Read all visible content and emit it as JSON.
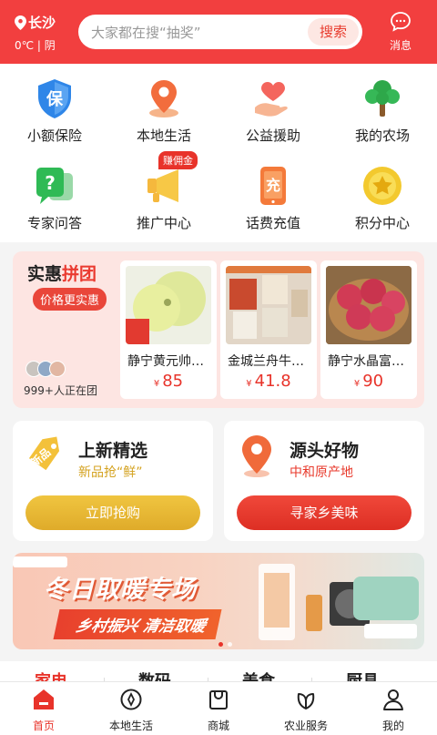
{
  "header": {
    "city": "长沙",
    "weather": "0℃ | 阴",
    "search_placeholder": "大家都在搜“抽奖”",
    "search_button": "搜索",
    "message_label": "消息"
  },
  "services": [
    {
      "label": "小额保险",
      "icon": "shield-bao-icon"
    },
    {
      "label": "本地生活",
      "icon": "map-pin-icon"
    },
    {
      "label": "公益援助",
      "icon": "hand-heart-icon"
    },
    {
      "label": "我的农场",
      "icon": "tree-icon"
    },
    {
      "label": "专家问答",
      "icon": "question-chat-icon"
    },
    {
      "label": "推广中心",
      "icon": "megaphone-icon"
    },
    {
      "label": "话费充值",
      "icon": "phone-charge-icon"
    },
    {
      "label": "积分中心",
      "icon": "star-coin-icon"
    }
  ],
  "promo_badge": "赚佣金",
  "group_buy": {
    "title_main": "实惠",
    "title_accent": "拼团",
    "subtitle": "价格更实惠",
    "participants": "999+人正在团",
    "products": [
      {
        "name": "静宁黄元帅苹果",
        "price": "85",
        "currency": "¥"
      },
      {
        "name": "金城兰舟牛肉面",
        "price": "41.8",
        "currency": "¥"
      },
      {
        "name": "静宁水晶富士苹果",
        "price": "90",
        "currency": "¥"
      }
    ]
  },
  "features": [
    {
      "title": "上新精选",
      "subtitle": "新品抢“鲜”",
      "button": "立即抢购",
      "icon": "new-tag-icon",
      "color": "#e5b935"
    },
    {
      "title": "源头好物",
      "subtitle": "中和原产地",
      "button": "寻家乡美味",
      "icon": "location-pin-icon",
      "color": "#e83a2c"
    }
  ],
  "banner": {
    "title": "冬日取暖专场",
    "ribbon": "乡村振兴 清洁取暖"
  },
  "categories": [
    "家电",
    "数码",
    "美食",
    "厨具"
  ],
  "nav": [
    {
      "label": "首页",
      "icon": "home-icon",
      "active": true
    },
    {
      "label": "本地生活",
      "icon": "compass-icon",
      "active": false
    },
    {
      "label": "商城",
      "icon": "shopping-bag-icon",
      "active": false
    },
    {
      "label": "农业服务",
      "icon": "leaf-icon",
      "active": false
    },
    {
      "label": "我的",
      "icon": "user-icon",
      "active": false
    }
  ],
  "colors": {
    "brand": "#f23f3f",
    "accent": "#e8332a",
    "gold": "#e5b935"
  }
}
